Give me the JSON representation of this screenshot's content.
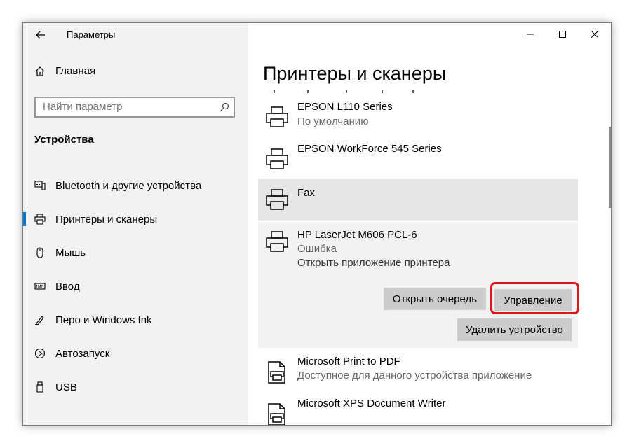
{
  "window": {
    "title": "Параметры"
  },
  "sidebar": {
    "home_label": "Главная",
    "search_placeholder": "Найти параметр",
    "section_title": "Устройства",
    "items": [
      {
        "label": "Bluetooth и другие устройства",
        "icon": "bluetooth-devices-icon"
      },
      {
        "label": "Принтеры и сканеры",
        "icon": "printer-icon",
        "active": true
      },
      {
        "label": "Мышь",
        "icon": "mouse-icon"
      },
      {
        "label": "Ввод",
        "icon": "keyboard-icon"
      },
      {
        "label": "Перо и Windows Ink",
        "icon": "pen-icon"
      },
      {
        "label": "Автозапуск",
        "icon": "autoplay-icon"
      },
      {
        "label": "USB",
        "icon": "usb-icon"
      }
    ]
  },
  "main": {
    "heading": "Принтеры и сканеры",
    "printers": [
      {
        "name": "EPSON L110 Series",
        "status": "По умолчанию"
      },
      {
        "name": "EPSON WorkForce 545 Series"
      },
      {
        "name": "Fax"
      },
      {
        "name": "HP LaserJet M606 PCL-6",
        "status": "Ошибка",
        "link": "Открыть приложение принтера"
      },
      {
        "name": "Microsoft Print to PDF",
        "status": "Доступное для данного устройства приложение"
      },
      {
        "name": "Microsoft XPS Document Writer"
      }
    ],
    "buttons": {
      "open_queue": "Открыть очередь",
      "manage": "Управление",
      "remove_device": "Удалить устройство"
    }
  },
  "colors": {
    "highlight": "#e0141e",
    "accent": "#0078d7",
    "selected_bg": "#e6e6e6",
    "expanded_bg": "#f2f2f2"
  }
}
